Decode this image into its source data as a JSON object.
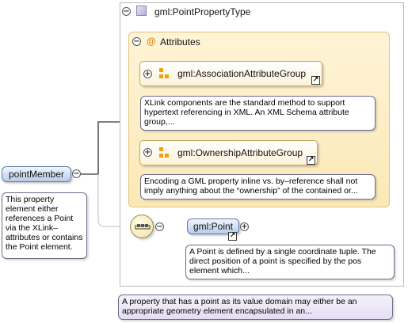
{
  "type_frame": {
    "title": "gml:PointPropertyType",
    "toggle": "−"
  },
  "attributes": {
    "title": "Attributes",
    "toggle": "−",
    "icon": "@",
    "groups": [
      {
        "label": "gml:AssociationAttributeGroup",
        "toggle": "+",
        "description": "XLink components are the standard method to support hypertext referencing in XML. An XML Schema attribute group,..."
      },
      {
        "label": "gml:OwnershipAttributeGroup",
        "toggle": "+",
        "description": "Encoding a GML property inline vs. by–reference shall not imply anything about the “ownership” of the contained or..."
      }
    ]
  },
  "root_element": {
    "label": "pointMember",
    "toggle": "−",
    "description": "This property element either references a Point via the XLink–attributes or contains the Point element."
  },
  "sequence": {
    "toggle": "−",
    "icon": "sequence-icon"
  },
  "child_element": {
    "label": "gml:Point",
    "toggle": "+",
    "description": "A Point is defined by a single coordinate tuple. The direct position of a point is specified by the pos element which..."
  },
  "type_description": "A property that has a point as its value domain may either be an appropriate geometry element encapsulated in an...",
  "colors": {
    "attr_bg": "#fbe8b7",
    "element_bg": "#b8cde9",
    "note_bg": "#e4def3",
    "seq_bg": "#f2e3a3"
  }
}
